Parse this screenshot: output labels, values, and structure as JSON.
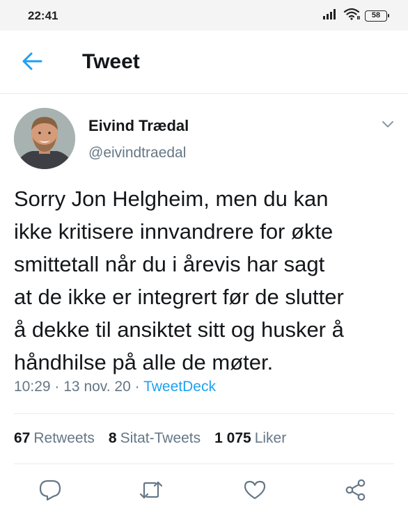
{
  "status_bar": {
    "time": "22:41",
    "battery": "58",
    "icons": [
      "signal-icon",
      "wifi-icon",
      "battery-icon"
    ]
  },
  "header": {
    "title": "Tweet",
    "back_icon": "arrow-left-icon"
  },
  "tweet": {
    "author_name": "Eivind Trædal",
    "author_handle": "@eivindtraedal",
    "text": "Sorry Jon Helgheim, men du kan\nikke kritisere innvandrere for økte\nsmittetall når du i årevis har sagt\nat de ikke er integrert før de slutter\nå dekke til ansiktet sitt og husker å\nhåndhilse på alle de møter.",
    "time": "10:29",
    "date": "13 nov. 20",
    "source": "TweetDeck",
    "separator": "·"
  },
  "stats": {
    "retweets_count": "67",
    "retweets_label": "Retweets",
    "quotes_count": "8",
    "quotes_label": "Sitat-Tweets",
    "likes_count": "1 075",
    "likes_label": "Liker"
  },
  "actions": [
    "reply-icon",
    "retweet-icon",
    "like-icon",
    "share-icon"
  ],
  "colors": {
    "accent": "#1da1f2",
    "text_primary": "#14171a",
    "text_secondary": "#657786",
    "divider": "#e6ecf0",
    "status_bar_bg": "#f4f4f4"
  }
}
